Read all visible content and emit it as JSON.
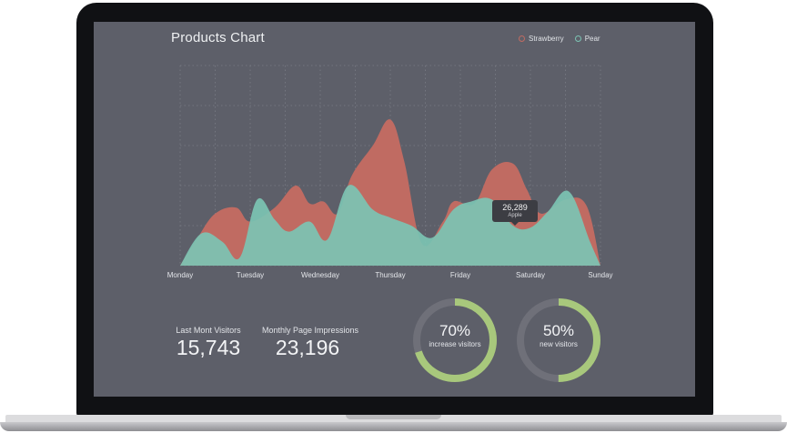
{
  "chart_data": {
    "type": "area",
    "title": "Products Chart",
    "categories": [
      "Monday",
      "Tuesday",
      "Wednesday",
      "Thursday",
      "Friday",
      "Saturday",
      "Sunday"
    ],
    "ylim": [
      0,
      100
    ],
    "grid": true,
    "legend_position": "top-right",
    "series": [
      {
        "name": "Strawberry",
        "color": "#c06b62",
        "x": [
          0,
          0.25,
          0.5,
          0.8,
          1.0,
          1.35,
          1.65,
          1.85,
          2.05,
          2.25,
          2.45,
          2.75,
          3.0,
          3.2,
          3.45,
          3.75,
          3.9,
          4.2,
          4.45,
          4.75,
          4.95,
          5.15,
          5.5,
          5.8,
          6.0
        ],
        "values": [
          0,
          14,
          26,
          29,
          22,
          29,
          40,
          31,
          32,
          26,
          45,
          60,
          73,
          52,
          11,
          22,
          32,
          31,
          48,
          51,
          38,
          26,
          33,
          30,
          0
        ]
      },
      {
        "name": "Pear",
        "color": "#7cc4b3",
        "x": [
          0,
          0.3,
          0.6,
          0.85,
          1.1,
          1.35,
          1.55,
          1.85,
          2.1,
          2.4,
          2.75,
          3.0,
          3.3,
          3.6,
          3.9,
          4.15,
          4.45,
          4.75,
          5.0,
          5.25,
          5.55,
          5.85,
          6.0
        ],
        "values": [
          0,
          16,
          12,
          4,
          33,
          23,
          17,
          22,
          13,
          40,
          28,
          24,
          20,
          14,
          28,
          32,
          33,
          20,
          19,
          27,
          37,
          12,
          0
        ]
      }
    ],
    "tooltip": {
      "value": "26,289",
      "label": "Apple",
      "x": 4.65
    }
  },
  "stats": {
    "visitors": {
      "label": "Last Mont Visitors",
      "value": "15,743"
    },
    "impressions": {
      "label": "Monthly Page Impressions",
      "value": "23,196"
    }
  },
  "donuts": {
    "increase": {
      "percent": 70,
      "value": "70%",
      "label": "increase visitors",
      "color": "#a8c87c",
      "track": "#6f7079"
    },
    "new_visitors": {
      "percent": 50,
      "value": "50%",
      "label": "new visitors",
      "color": "#a8c87c",
      "track": "#6f7079"
    }
  },
  "colors": {
    "screen": "#5d5f69",
    "bezel": "#101114",
    "grid": "#7b7d86",
    "text": "#eef0f2"
  }
}
